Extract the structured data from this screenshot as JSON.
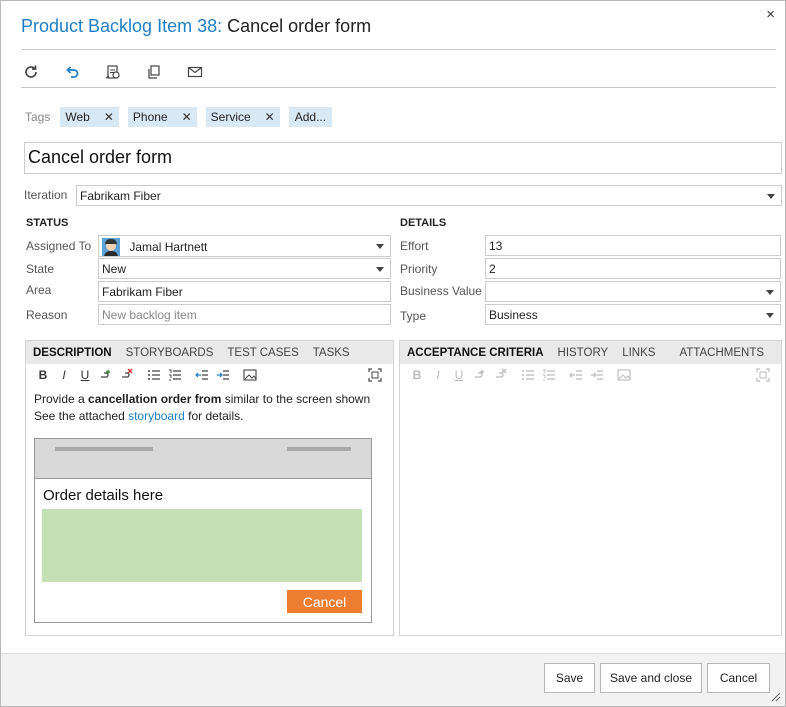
{
  "dialog": {
    "title_type": "Product Backlog Item 38:",
    "title_name": "Cancel order form",
    "close": "×"
  },
  "toolbar": {
    "icons": [
      "refresh-icon",
      "undo-icon",
      "link-work-item-icon",
      "copy-icon",
      "email-icon"
    ]
  },
  "tags": {
    "label": "Tags",
    "items": [
      "Web",
      "Phone",
      "Service"
    ],
    "remove": "✕",
    "add": "Add..."
  },
  "title_input": "Cancel order form",
  "iteration": {
    "label": "Iteration",
    "value": "Fabrikam Fiber"
  },
  "status": {
    "heading": "STATUS",
    "assigned_to": {
      "label": "Assigned To",
      "value": "Jamal Hartnett"
    },
    "state": {
      "label": "State",
      "value": "New"
    },
    "area": {
      "label": "Area",
      "value": "Fabrikam Fiber"
    },
    "reason": {
      "label": "Reason",
      "value": "New backlog item"
    }
  },
  "details": {
    "heading": "DETAILS",
    "effort": {
      "label": "Effort",
      "value": "13"
    },
    "priority": {
      "label": "Priority",
      "value": "2"
    },
    "business_value": {
      "label": "Business Value",
      "value": ""
    },
    "type": {
      "label": "Type",
      "value": "Business"
    }
  },
  "left_tabs": [
    "DESCRIPTION",
    "STORYBOARDS",
    "TEST CASES",
    "TASKS"
  ],
  "right_tabs": [
    "ACCEPTANCE CRITERIA",
    "HISTORY",
    "LINKS",
    "ATTACHMENTS"
  ],
  "editor": {
    "bold": "B",
    "italic": "I",
    "underline": "U"
  },
  "description": {
    "line1_pre": "Provide a ",
    "line1_bold": "cancellation order from",
    "line1_post": " similar to the screen shown",
    "line2_pre": "See the attached ",
    "line2_link": "storyboard",
    "line2_post": " for details.",
    "mockup_title": "Order details here",
    "mockup_button": "Cancel"
  },
  "colors": {
    "accent": "#1f7fc4",
    "tag_bg": "#d9e8f5",
    "mockup_green": "#c5e0b4",
    "mockup_orange": "#ed7d31"
  },
  "footer": {
    "save": "Save",
    "save_close": "Save and close",
    "cancel": "Cancel"
  }
}
